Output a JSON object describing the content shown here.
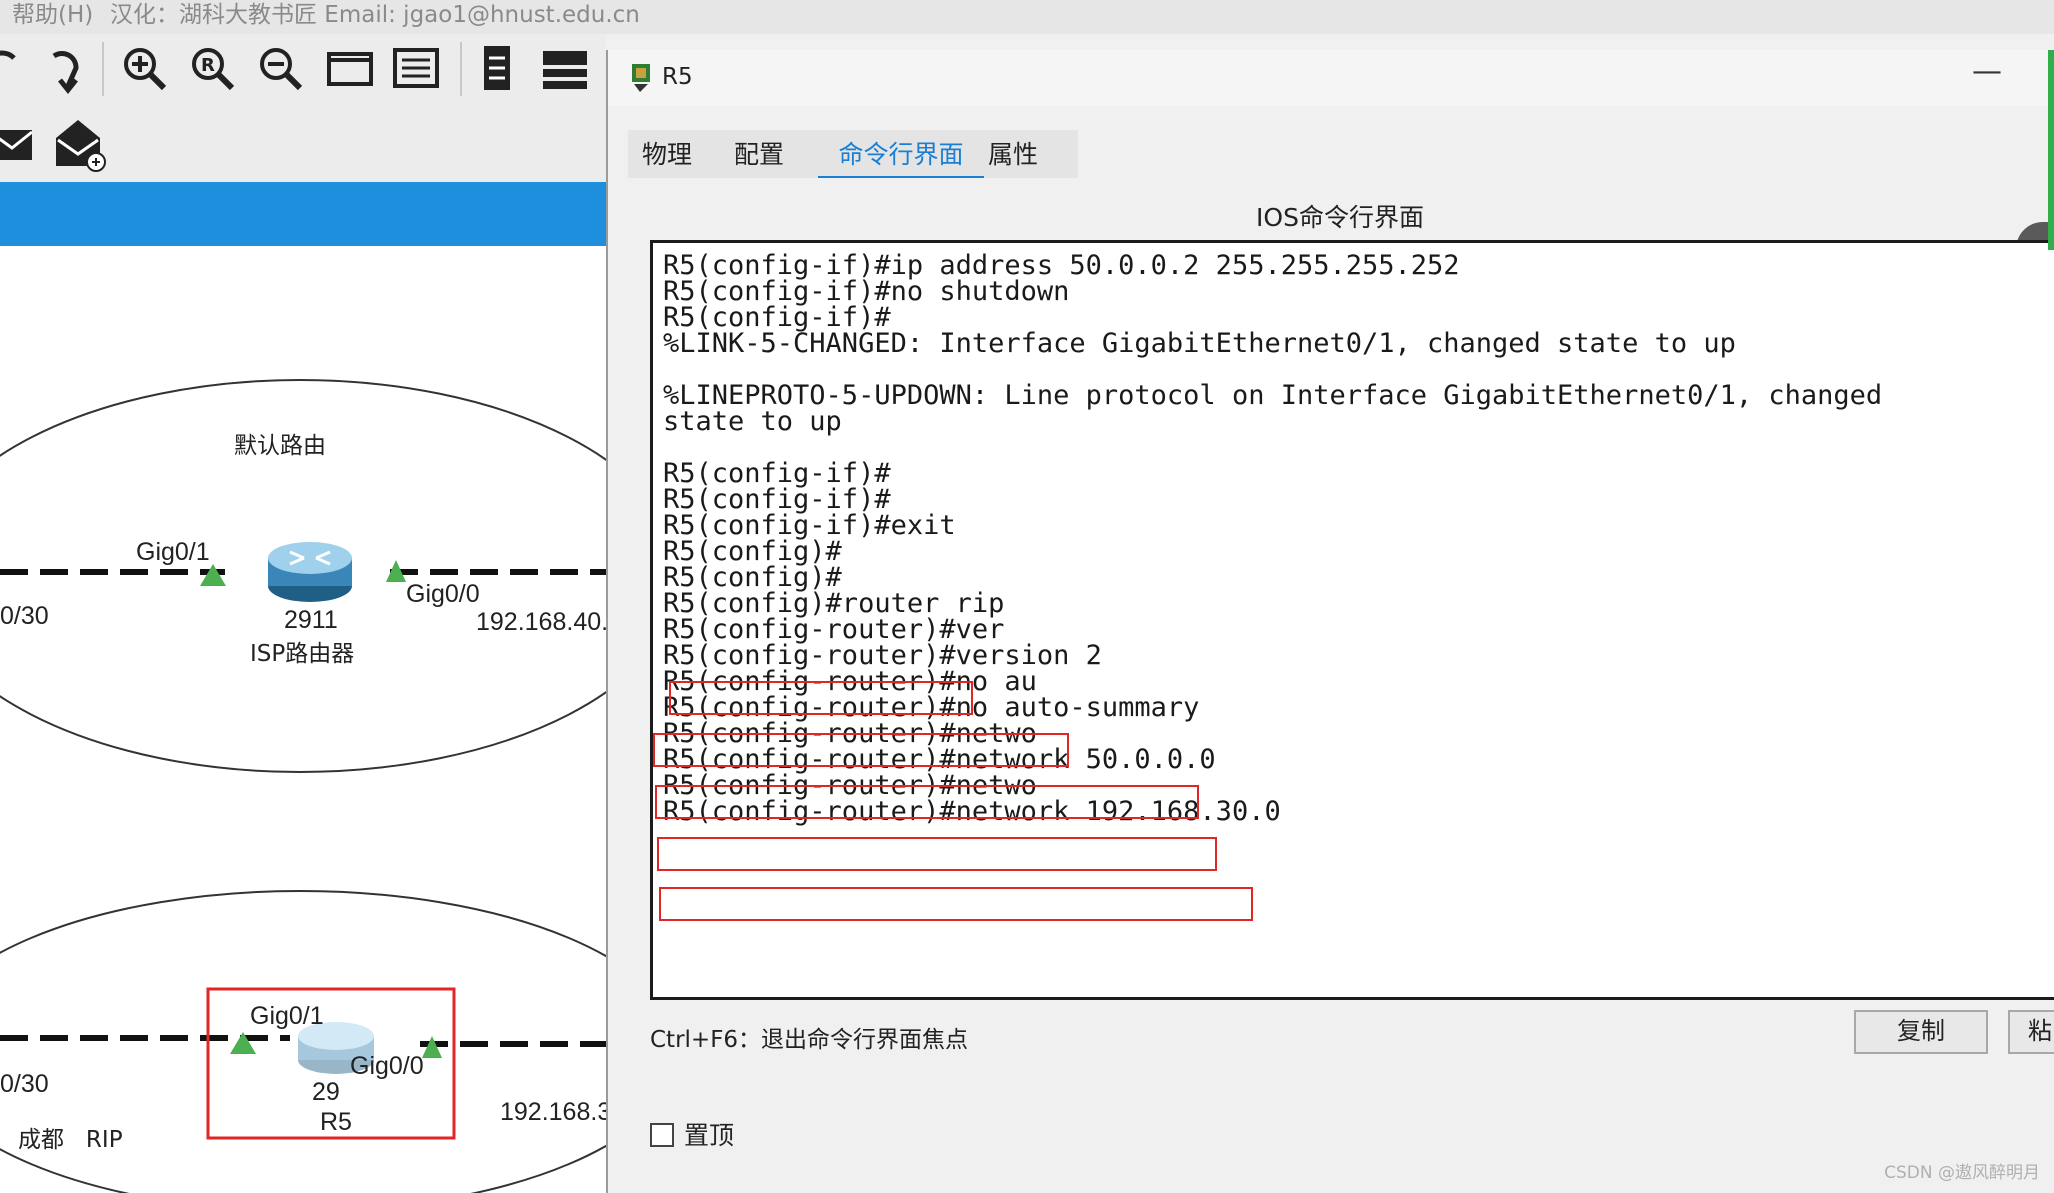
{
  "menubar": {
    "help": "帮助(H)",
    "credit": "汉化：湖科大教书匠 Email: jgao1@hnust.edu.cn"
  },
  "toolbar": {
    "icons": [
      "redo-icon",
      "zoom-in-icon",
      "zoom-reset-icon",
      "zoom-out-icon",
      "rectangle-icon",
      "palette-icon",
      "notes-icon",
      "device-icon",
      "mail-icon",
      "open-mail-icon"
    ]
  },
  "topology": {
    "region_top_label": "默认路由",
    "isp_router": {
      "port_left": "Gig0/1",
      "port_right": "Gig0/0",
      "model": "2911",
      "name": "ISP路由器",
      "left_net": "0/30",
      "right_net": "192.168.40."
    },
    "r5_router": {
      "port_left": "Gig0/1",
      "port_right": "Gig0/0",
      "model": "29",
      "name": "R5",
      "left_net": "0/30",
      "right_net": "192.168.3"
    },
    "region_bottom_label": "成都   RIP"
  },
  "window": {
    "title": "R5",
    "minimize": "—",
    "tabs": [
      {
        "label": "物理",
        "active": false
      },
      {
        "label": "配置",
        "active": false
      },
      {
        "label": "命令行界面",
        "active": true
      },
      {
        "label": "属性",
        "active": false
      }
    ],
    "ios_title": "IOS命令行界面",
    "collapse": "‹",
    "terminal_lines": [
      "R5(config-if)#ip address 50.0.0.2 255.255.255.252",
      "R5(config-if)#no shutdown",
      "R5(config-if)#",
      "%LINK-5-CHANGED: Interface GigabitEthernet0/1, changed state to up",
      "",
      "%LINEPROTO-5-UPDOWN: Line protocol on Interface GigabitEthernet0/1, changed",
      "state to up",
      "",
      "R5(config-if)#",
      "R5(config-if)#",
      "R5(config-if)#exit",
      "R5(config)#",
      "R5(config)#",
      "R5(config)#router rip",
      "R5(config-router)#ver",
      "R5(config-router)#version 2",
      "R5(config-router)#no au",
      "R5(config-router)#no auto-summary",
      "R5(config-router)#netwo",
      "R5(config-router)#network 50.0.0.0",
      "R5(config-router)#netwo",
      "R5(config-router)#network 192.168.30.0"
    ],
    "hint": "Ctrl+F6：退出命令行界面焦点",
    "copy_button": "复制",
    "paste_button": "粘",
    "pin_label": "置顶"
  },
  "watermark": "CSDN @遨风醉明月",
  "colors": {
    "accent_blue": "#1a7fd3",
    "highlight_red": "#e12626",
    "link_green": "#4caf50",
    "toolbar_blue": "#1e8fdc"
  }
}
